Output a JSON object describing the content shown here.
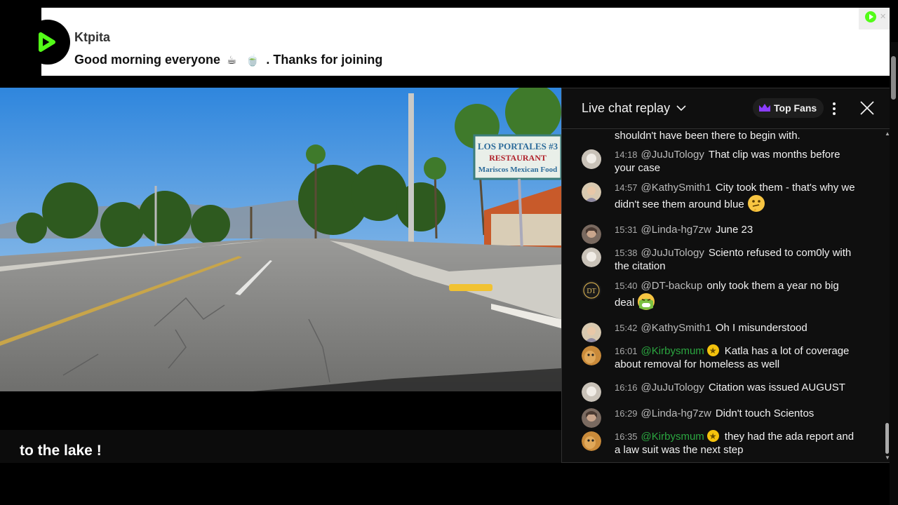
{
  "banner": {
    "username": "Ktpita",
    "message_start": "Good morning everyone",
    "emoji_1": "☕",
    "emoji_2": "🍵",
    "message_end": ". Thanks for joining"
  },
  "video": {
    "sign_line1": "LOS PORTALES #3",
    "sign_line2": "RESTAURANT",
    "sign_line3": "Mariscos Mexican Food",
    "caption": "to the lake !"
  },
  "chat": {
    "title": "Live chat replay",
    "top_fans_label": "Top Fans",
    "partial_message": "shouldn't have been there to begin with.",
    "messages": [
      {
        "time": "14:18",
        "author": "@JuJuTology",
        "text": "That clip was months before your case"
      },
      {
        "time": "14:57",
        "author": "@KathySmith1",
        "text": "City took them - that's why we didn't see them around blue"
      },
      {
        "time": "15:31",
        "author": "@Linda-hg7zw",
        "text": "June 23"
      },
      {
        "time": "15:38",
        "author": "@JuJuTology",
        "text": "Sciento refused to com0ly with the citation"
      },
      {
        "time": "15:40",
        "author": "@DT-backup",
        "text": "only took them a year no big deal"
      },
      {
        "time": "15:42",
        "author": "@KathySmith1",
        "text": "Oh I misunderstood"
      },
      {
        "time": "16:01",
        "author": "@Kirbysmum",
        "text": "Katla has a lot of coverage about removal for homeless as well"
      },
      {
        "time": "16:16",
        "author": "@JuJuTology",
        "text": "Citation was issued AUGUST"
      },
      {
        "time": "16:29",
        "author": "@Linda-hg7zw",
        "text": "Didn't touch Scientos"
      },
      {
        "time": "16:35",
        "author": "@Kirbysmum",
        "text": "they had the ada report and a law suit was the next step"
      }
    ],
    "avatar_dt_text": "DT"
  },
  "colors": {
    "brand_green": "#53fc18",
    "member_green": "#2ba640",
    "chat_bg": "#0f0f0f"
  }
}
